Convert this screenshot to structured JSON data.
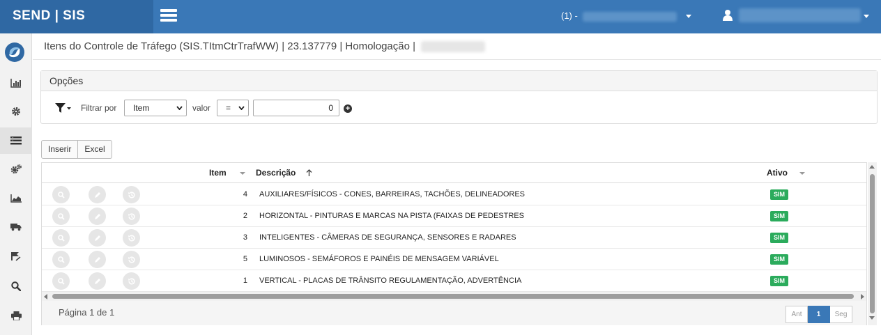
{
  "topbar": {
    "brand": "SEND | SIS",
    "context_label": "(1) -",
    "colors": {
      "bar": "#3a78b7",
      "brand_bg": "#2f68a3"
    }
  },
  "sidebar": {
    "items": [
      {
        "icon": "bar-chart-icon"
      },
      {
        "icon": "gear-icon"
      },
      {
        "icon": "list-icon",
        "active": true
      },
      {
        "icon": "gears-icon"
      },
      {
        "icon": "area-chart-icon"
      },
      {
        "icon": "truck-icon"
      },
      {
        "icon": "road-flag-icon"
      },
      {
        "icon": "search-icon"
      },
      {
        "icon": "print-icon"
      }
    ]
  },
  "page": {
    "title": "Itens do Controle de Tráfego (SIS.TItmCtrTrafWW) | 23.137779 | Homologação |"
  },
  "options": {
    "heading": "Opções",
    "filter_by_label": "Filtrar por",
    "field_selected": "Item",
    "value_label": "valor",
    "operator_selected": "=",
    "value": "0"
  },
  "toolbar": {
    "insert_label": "Inserir",
    "excel_label": "Excel"
  },
  "grid": {
    "columns": {
      "item": "Item",
      "description": "Descrição",
      "active": "Ativo"
    },
    "rows": [
      {
        "item": "4",
        "description": "AUXILIARES/FÍSICOS - CONES, BARREIRAS, TACHÕES, DELINEADORES",
        "active": "SIM"
      },
      {
        "item": "2",
        "description": "HORIZONTAL - PINTURAS E MARCAS NA PISTA (FAIXAS DE PEDESTRES",
        "active": "SIM"
      },
      {
        "item": "3",
        "description": "INTELIGENTES - CÂMERAS DE SEGURANÇA, SENSORES E RADARES",
        "active": "SIM"
      },
      {
        "item": "5",
        "description": "LUMINOSOS - SEMÁFOROS E PAINÉIS DE MENSAGEM VARIÁVEL",
        "active": "SIM"
      },
      {
        "item": "1",
        "description": "VERTICAL - PLACAS DE TRÂNSITO REGULAMENTAÇÃO, ADVERTÊNCIA",
        "active": "SIM"
      }
    ],
    "footer": {
      "page_info": "Página 1 de 1",
      "prev_label": "Ant",
      "current_page": "1",
      "next_label": "Seg"
    },
    "colors": {
      "badge": "#2bab5c",
      "pager_active": "#3a78b7"
    }
  }
}
